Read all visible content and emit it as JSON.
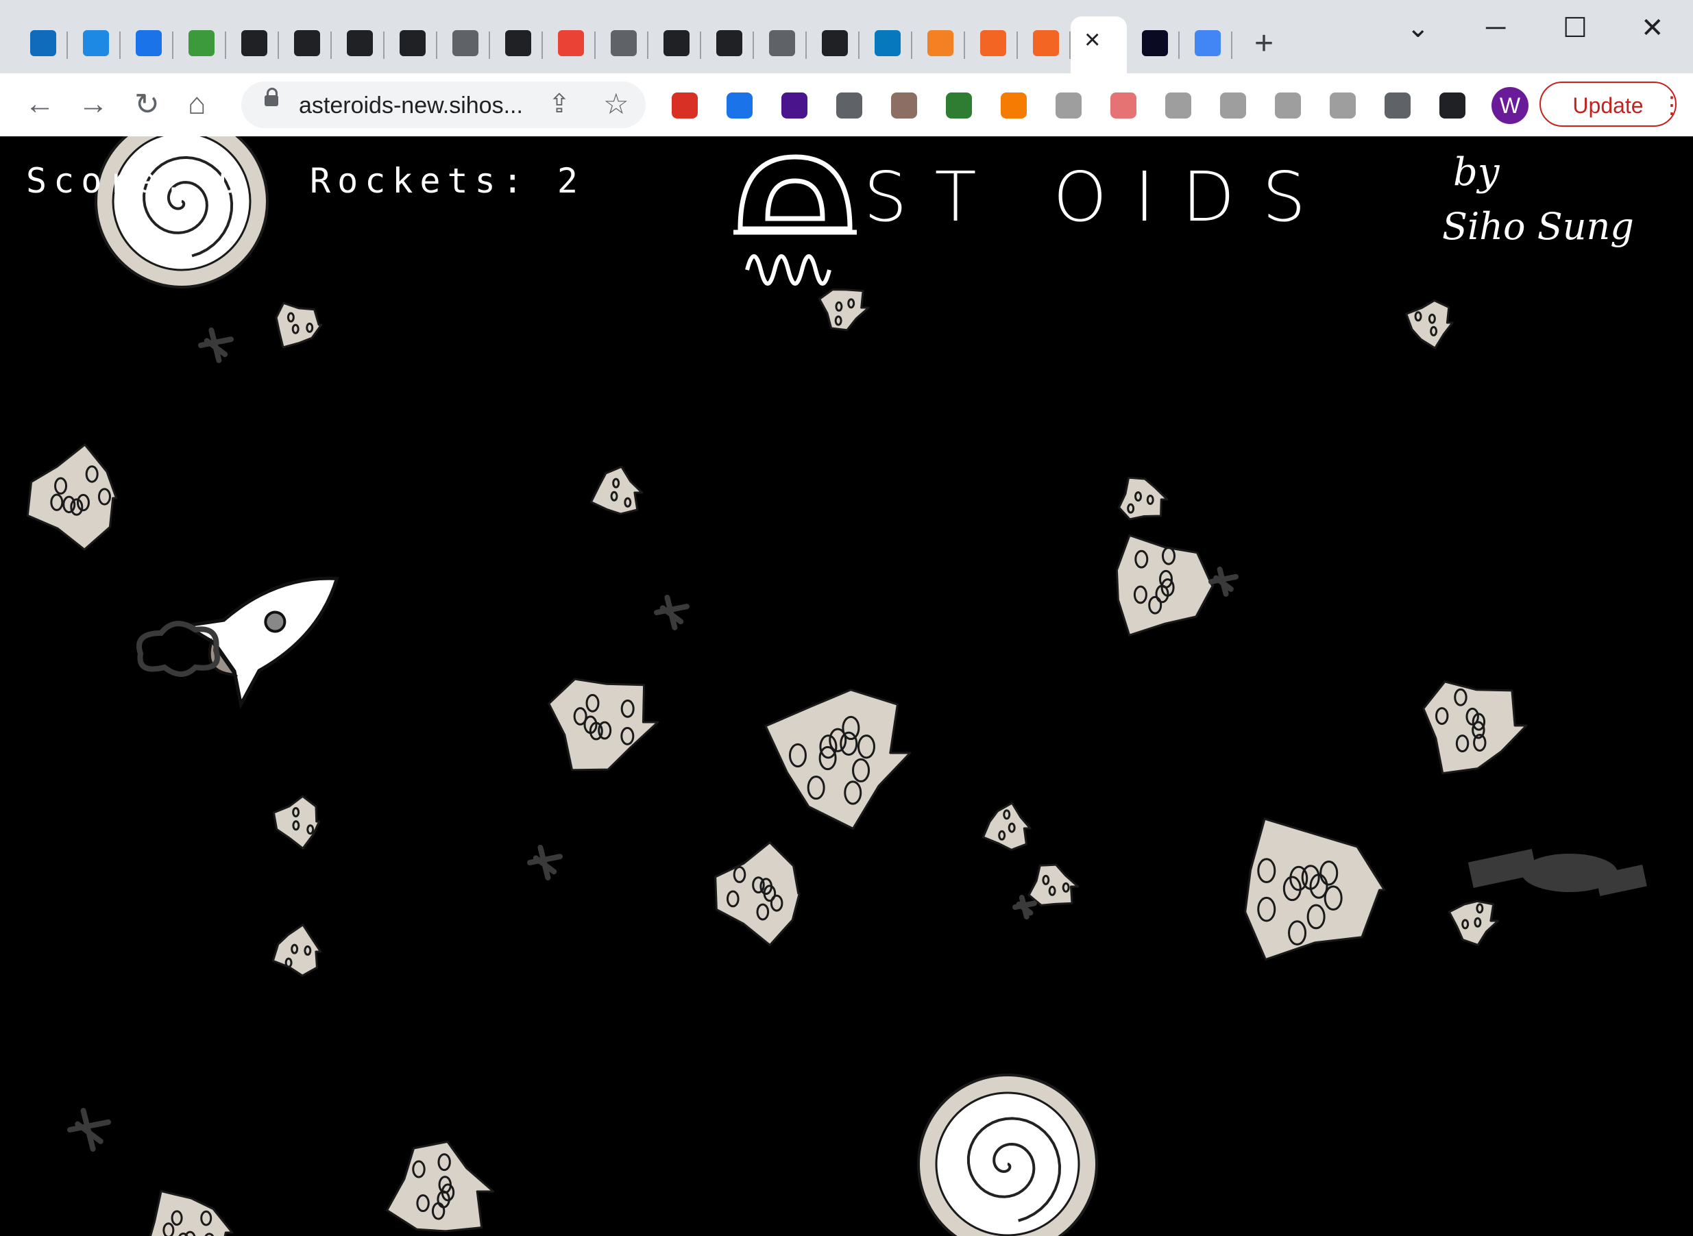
{
  "browser": {
    "tabs": [
      {
        "icon": "outlook-icon",
        "color": "#0f6cbd"
      },
      {
        "icon": "office-icon",
        "color": "#1e88e5"
      },
      {
        "icon": "vimeo-icon",
        "color": "#1a73e8"
      },
      {
        "icon": "leaf-icon",
        "color": "#3c9a3c"
      },
      {
        "icon": "triangle-icon",
        "color": "#202124"
      },
      {
        "icon": "triangle-icon",
        "color": "#202124"
      },
      {
        "icon": "triangle-icon",
        "color": "#202124"
      },
      {
        "icon": "triangle-icon",
        "color": "#202124"
      },
      {
        "icon": "globe-icon",
        "color": "#5f6368"
      },
      {
        "icon": "github-icon",
        "color": "#202124"
      },
      {
        "icon": "gmail-icon",
        "color": "#ea4335"
      },
      {
        "icon": "globe-icon",
        "color": "#5f6368"
      },
      {
        "icon": "github-icon",
        "color": "#202124"
      },
      {
        "icon": "github-icon",
        "color": "#202124"
      },
      {
        "icon": "globe-icon",
        "color": "#5f6368"
      },
      {
        "icon": "github-icon",
        "color": "#202124"
      },
      {
        "icon": "drupal-icon",
        "color": "#0678be"
      },
      {
        "icon": "stackoverflow-icon",
        "color": "#f48024"
      },
      {
        "icon": "orange-blocks-icon",
        "color": "#f26522"
      },
      {
        "icon": "orange-blocks-icon",
        "color": "#f26522"
      }
    ],
    "active_tab_close": "×",
    "after_tabs": [
      {
        "icon": "devcode-icon",
        "color": "#0a0a23"
      },
      {
        "icon": "google-icon",
        "color": "#4285f4"
      }
    ],
    "new_tab_glyph": "+",
    "window_controls": {
      "dropdown": "⌄",
      "minimize": "─",
      "maximize": "☐",
      "close": "✕"
    },
    "nav": {
      "back": "←",
      "forward": "→",
      "reload": "↻",
      "home": "⌂"
    },
    "url": "asteroids-new.sihos...",
    "share_glyph": "⇪",
    "star_glyph": "☆",
    "extensions": [
      "#d93025",
      "#1a73e8",
      "#4a148c",
      "#5f6368",
      "#8d6e63",
      "#2e7d32",
      "#f57c00",
      "#9e9e9e",
      "#e57373",
      "#9e9e9e",
      "#9e9e9e",
      "#9e9e9e",
      "#9e9e9e",
      "#5f6368",
      "#202124"
    ],
    "profile_initial": "W",
    "update_label": "Update",
    "menu_glyph": "⋮"
  },
  "game": {
    "score_label": "Score: 0",
    "rockets_label": "Rockets: 2",
    "title": "ST  OIDS",
    "by": "by",
    "author": "Siho Sung",
    "colors": {
      "background": "#000000",
      "asteroid": "#d8d2c8",
      "stroke": "#1a1a1a",
      "debris": "#3a3a3a"
    }
  }
}
